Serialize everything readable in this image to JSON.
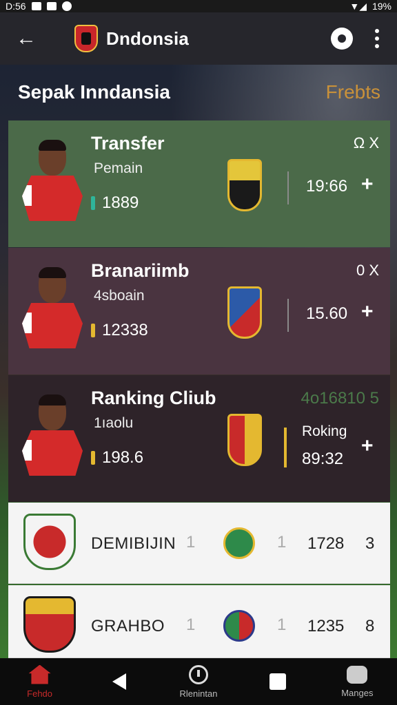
{
  "status_bar": {
    "time": "D:56",
    "battery": "19%"
  },
  "app_bar": {
    "title": "Dndonsia"
  },
  "section": {
    "title": "Sepak Inndansia",
    "link": "Frebts"
  },
  "cards": [
    {
      "title": "Transfer",
      "subtitle": "Pemain",
      "stat": "1889",
      "time": "19:66",
      "plus": "+",
      "corner": "Ω X",
      "bar_color": "#2fb59a",
      "badge_colors": [
        "#e4c63a",
        "#1a1a1a"
      ]
    },
    {
      "title": "Branariimb",
      "subtitle": "4sboain",
      "stat": "12338",
      "time": "15.60",
      "plus": "+",
      "corner": "0 X",
      "bar_color": "#e4b830",
      "badge_colors": [
        "#2c5aa8",
        "#c82a2a"
      ]
    },
    {
      "title": "Ranking Cliub",
      "subtitle": "1ıaolu",
      "stat": "198.6",
      "label": "Roking",
      "time": "89:32",
      "plus": "+",
      "corner": "4o16810 5",
      "bar_color": "#e4b830",
      "badge_colors": [
        "#c82a2a",
        "#e4b830"
      ]
    }
  ],
  "rows": [
    {
      "name": "DEMIBIJIN",
      "sep1": "1",
      "sep2": "1",
      "score": "1728",
      "rank": "3"
    },
    {
      "name": "GRAHBO",
      "sep1": "1",
      "sep2": "1",
      "score": "1235",
      "rank": "8"
    }
  ],
  "nav": [
    {
      "label": "Fehdo",
      "icon": "home-icon"
    },
    {
      "label": "",
      "icon": "back-icon"
    },
    {
      "label": "Rlenintan",
      "icon": "clock-icon"
    },
    {
      "label": "",
      "icon": "square-icon"
    },
    {
      "label": "Manges",
      "icon": "chat-icon"
    }
  ]
}
